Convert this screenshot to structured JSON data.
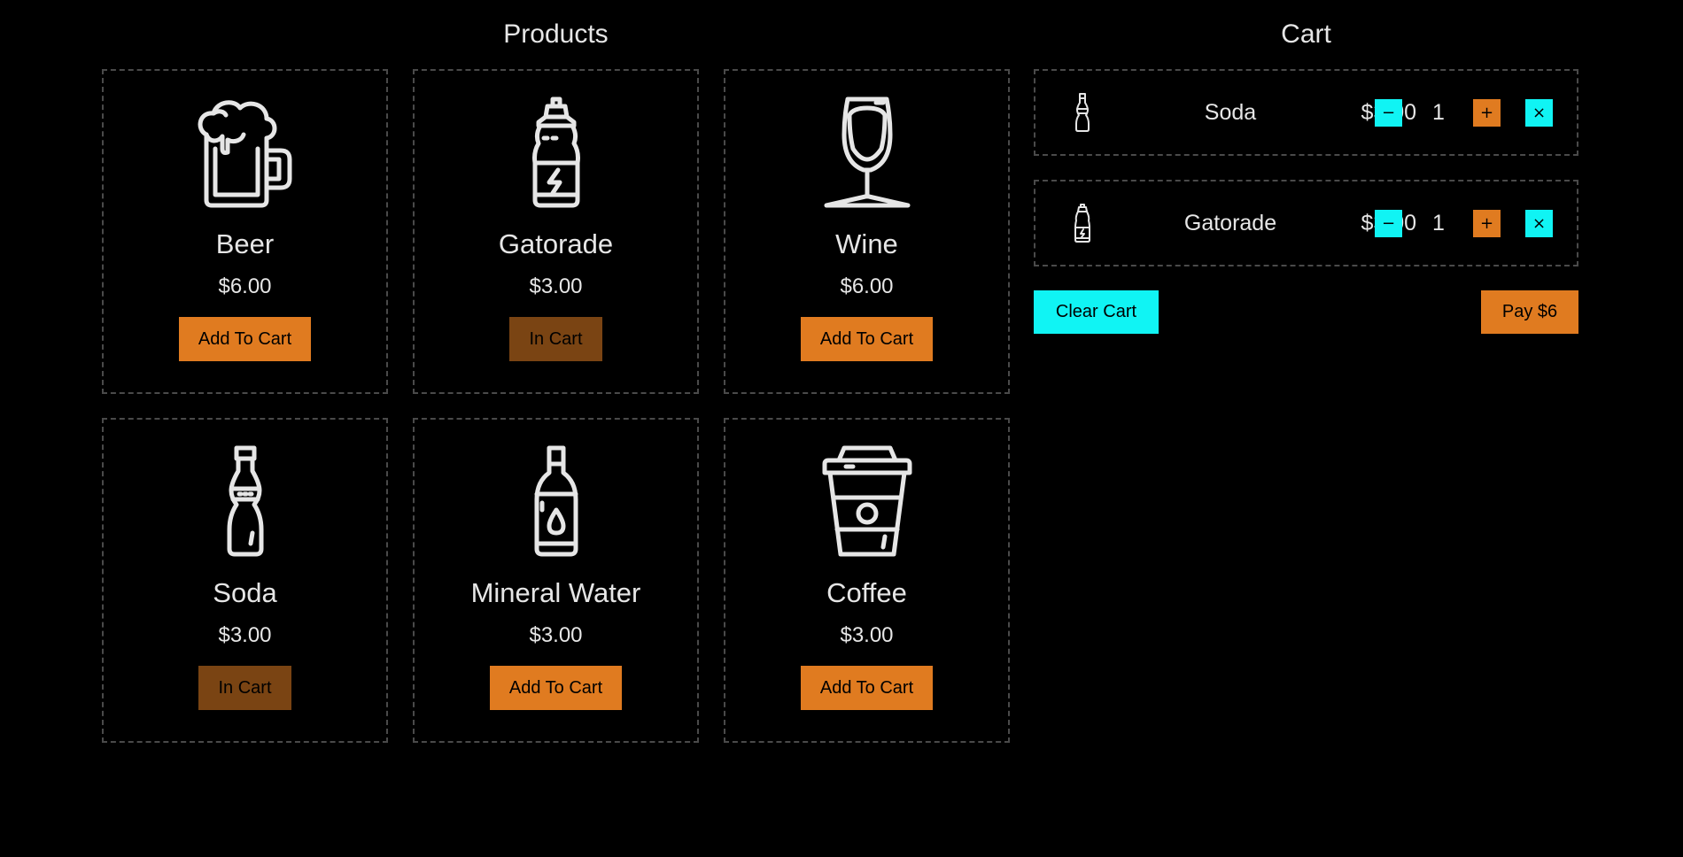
{
  "products": {
    "title": "Products",
    "items": [
      {
        "name": "Beer",
        "price": "$6.00",
        "button": "Add To Cart",
        "icon": "beer-mug-icon",
        "in_cart": false
      },
      {
        "name": "Gatorade",
        "price": "$3.00",
        "button": "In Cart",
        "icon": "sports-bottle-icon",
        "in_cart": true
      },
      {
        "name": "Wine",
        "price": "$6.00",
        "button": "Add To Cart",
        "icon": "wine-glass-icon",
        "in_cart": false
      },
      {
        "name": "Soda",
        "price": "$3.00",
        "button": "In Cart",
        "icon": "soda-bottle-icon",
        "in_cart": true
      },
      {
        "name": "Mineral Water",
        "price": "$3.00",
        "button": "Add To Cart",
        "icon": "water-bottle-icon",
        "in_cart": false
      },
      {
        "name": "Coffee",
        "price": "$3.00",
        "button": "Add To Cart",
        "icon": "coffee-cup-icon",
        "in_cart": false
      }
    ]
  },
  "cart": {
    "title": "Cart",
    "items": [
      {
        "name": "Soda",
        "price": "$3.00",
        "qty": "1",
        "icon": "soda-bottle-icon",
        "minus": "−",
        "plus": "+",
        "remove": "×"
      },
      {
        "name": "Gatorade",
        "price": "$3.00",
        "qty": "1",
        "icon": "sports-bottle-icon",
        "minus": "−",
        "plus": "+",
        "remove": "×"
      }
    ],
    "clear_label": "Clear Cart",
    "pay_label": "Pay $6"
  },
  "colors": {
    "background": "#000000",
    "accent_orange": "#e07b20",
    "in_cart_orange": "#7a4413",
    "accent_cyan": "#10f4f4",
    "text": "#e6e6e6",
    "border": "#4a4a4a"
  }
}
